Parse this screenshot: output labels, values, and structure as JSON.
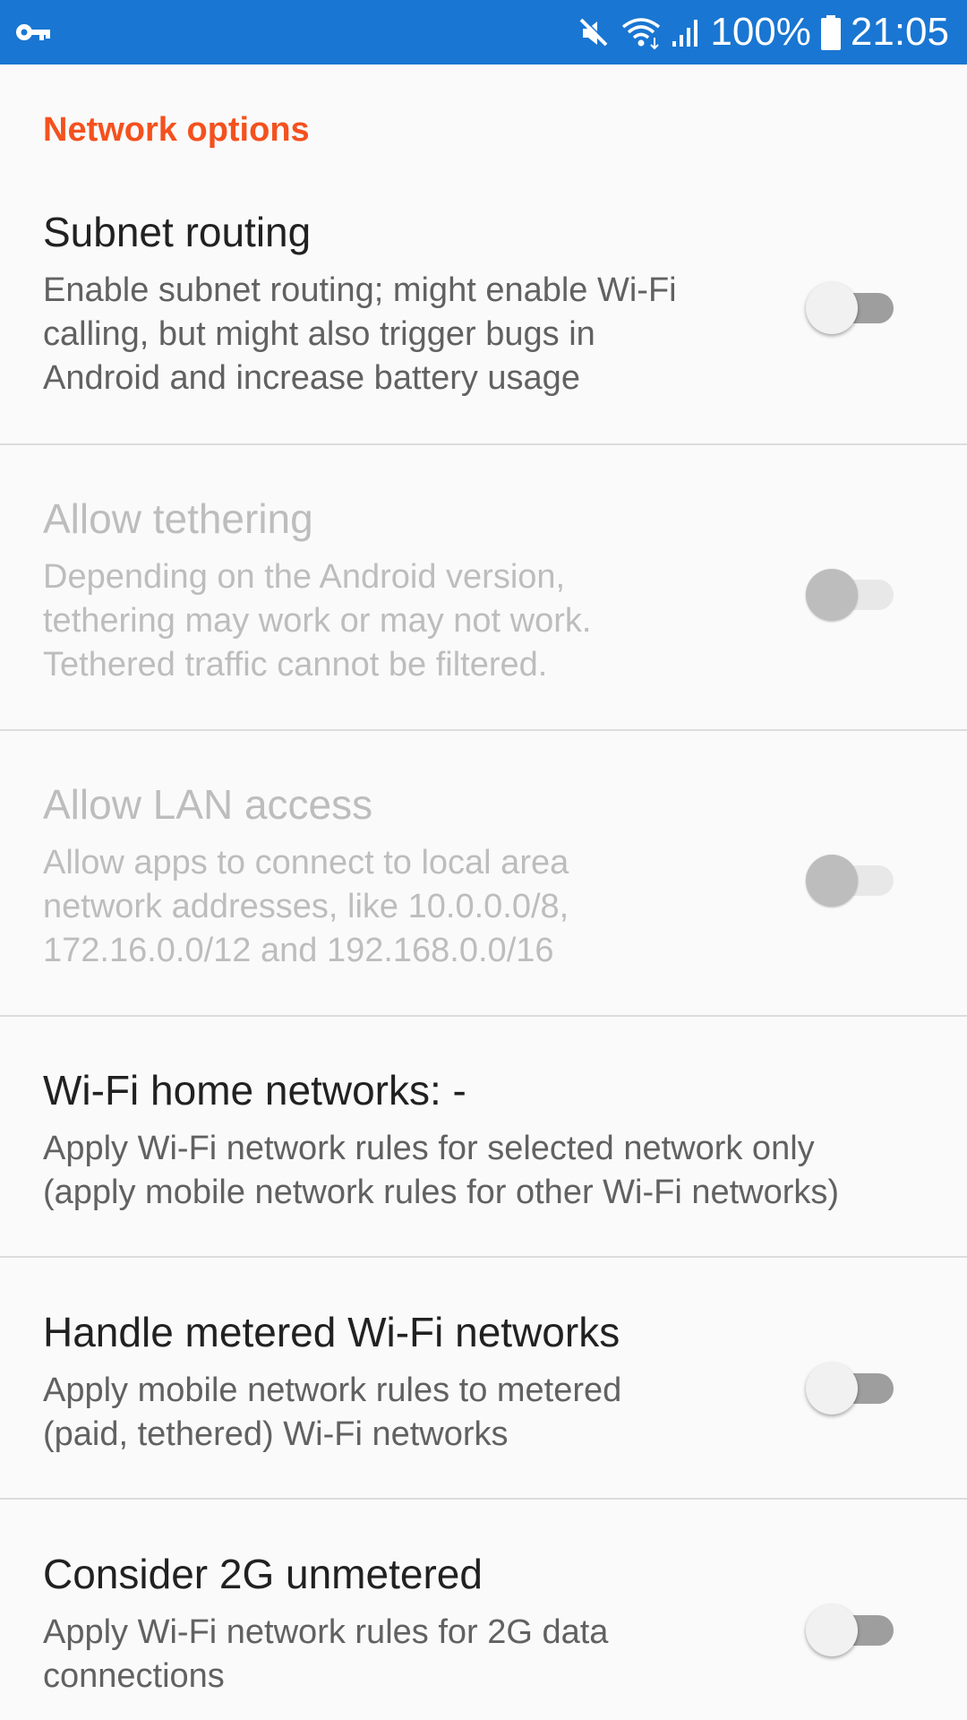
{
  "status_bar": {
    "battery_percent": "100%",
    "time": "21:05",
    "background_color": "#1976d2",
    "left_icon": "vpn-key-icon",
    "right_icons": [
      "mute-icon",
      "wifi-icon",
      "signal-icon",
      "battery-icon"
    ]
  },
  "category": {
    "label": "Network options",
    "color": "#f4511e"
  },
  "preferences": [
    {
      "title": "Subnet routing",
      "summary": "Enable subnet routing; might enable Wi-Fi\ncalling, but might also trigger bugs in\nAndroid and increase battery usage",
      "enabled": true,
      "checked": false
    },
    {
      "title": "Allow tethering",
      "summary": "Depending on the Android version,\ntethering may work or may not work.\nTethered traffic cannot be filtered.",
      "enabled": false,
      "checked": false
    },
    {
      "title": "Allow LAN access",
      "summary": "Allow apps to connect to local area\nnetwork addresses, like 10.0.0.0/8,\n172.16.0.0/12 and 192.168.0.0/16",
      "enabled": false,
      "checked": false
    },
    {
      "title": "Wi-Fi home networks: -",
      "summary": "Apply Wi-Fi network rules for selected network only\n(apply mobile network rules for other Wi-Fi networks)",
      "enabled": true
    },
    {
      "title": "Handle metered Wi-Fi networks",
      "summary": "Apply mobile network rules to metered\n(paid, tethered) Wi-Fi networks",
      "enabled": true,
      "checked": false
    },
    {
      "title": "Consider 2G unmetered",
      "summary": "Apply Wi-Fi network rules for 2G data\nconnections",
      "enabled": true,
      "checked": false
    }
  ]
}
